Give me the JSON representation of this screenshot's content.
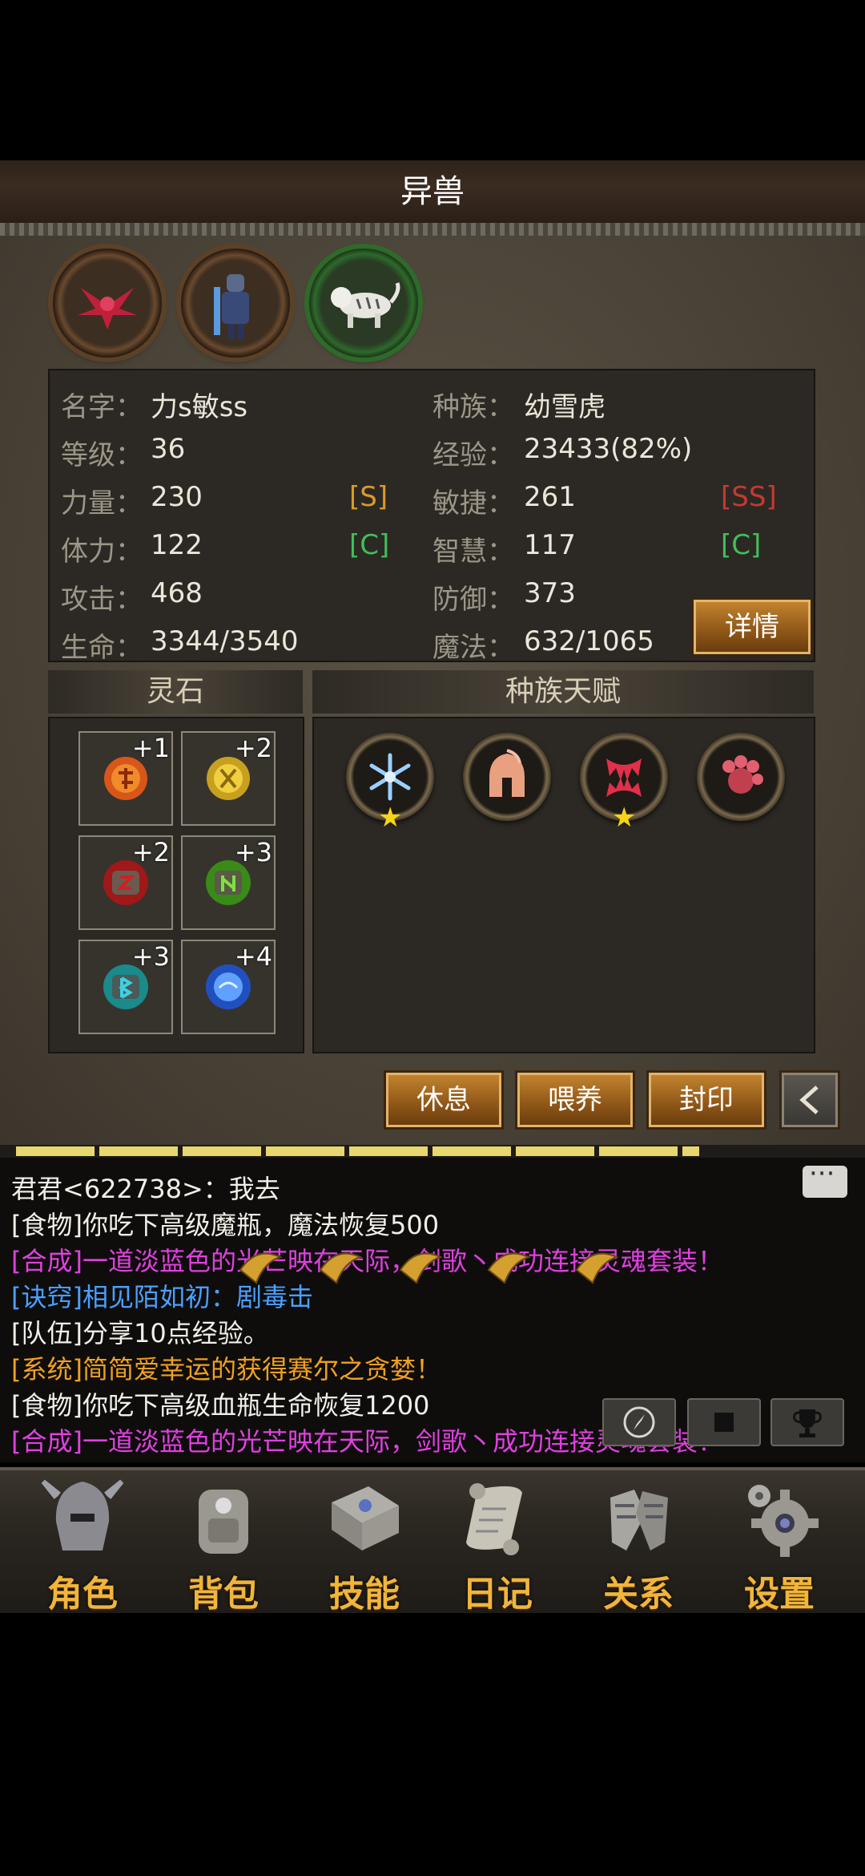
{
  "header": {
    "title": "异兽"
  },
  "stats": {
    "name_label": "名字：",
    "name_value": "力s敏ss",
    "race_label": "种族：",
    "race_value": "幼雪虎",
    "level_label": "等级：",
    "level_value": "36",
    "exp_label": "经验：",
    "exp_value": "23433(82%)",
    "str_label": "力量：",
    "str_value": "230",
    "str_grade": "[S]",
    "agi_label": "敏捷：",
    "agi_value": "261",
    "agi_grade": "[SS]",
    "vit_label": "体力：",
    "vit_value": "122",
    "vit_grade": "[C]",
    "int_label": "智慧：",
    "int_value": "117",
    "int_grade": "[C]",
    "atk_label": "攻击：",
    "atk_value": "468",
    "def_label": "防御：",
    "def_value": "373",
    "hp_label": "生命：",
    "hp_value": "3344/3540",
    "mp_label": "魔法：",
    "mp_value": "632/1065",
    "detail_button": "详情"
  },
  "spirit_stones": {
    "title": "灵石",
    "slots": [
      "+1",
      "+2",
      "+2",
      "+3",
      "+3",
      "+4"
    ]
  },
  "race_talent": {
    "title": "种族天赋"
  },
  "actions": {
    "rest": "休息",
    "feed": "喂养",
    "seal": "封印"
  },
  "experience_progress": 0.82,
  "chat": {
    "lines": [
      "君君<622738>：我去",
      "[食物]你吃下高级魔瓶，魔法恢复500",
      "[合成]一道淡蓝色的光芒映在天际，剑歌丶成功连接灵魂套装！",
      "[诀窍]相见陌如初：剧毒击",
      "[队伍]分享10点经验。",
      "[系统]简简爱幸运的获得赛尔之贪婪！",
      "[食物]你吃下高级血瓶生命恢复1200",
      "[合成]一道淡蓝色的光芒映在天际，剑歌丶成功连接灵魂套装！"
    ]
  },
  "nav": [
    "角色",
    "背包",
    "技能",
    "日记",
    "关系",
    "设置"
  ],
  "colors": {
    "chat_white": "#f2efe8",
    "chat_magenta": "#e040e0",
    "chat_blue": "#4aa0ff",
    "chat_orange": "#f0a020",
    "grade_s": "#d99a2a",
    "grade_ss": "#c43a30",
    "grade_c": "#3fbf5a",
    "nav_label": "#f0b53a"
  }
}
